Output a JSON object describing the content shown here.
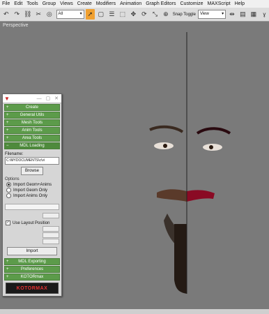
{
  "menu": [
    "File",
    "Edit",
    "Tools",
    "Group",
    "Views",
    "Create",
    "Modifiers",
    "Animation",
    "Graph Editors",
    "Customize",
    "MAXScript",
    "Help"
  ],
  "toolbar": {
    "selection_filter": "All",
    "snap_toggle": "Snap Toggle",
    "view_select": "View"
  },
  "viewport": {
    "label": "Perspective"
  },
  "panel": {
    "rollouts_top": [
      "Create",
      "General Utils",
      "Mesh Tools",
      "Anim Tools",
      "Area Tools"
    ],
    "open_rollout": "MDL Loading",
    "filename_label": "Filename:",
    "filename_value": "C:\\MYDOCUMENTS\\c\\vi",
    "browse": "Browse",
    "options_label": "Options",
    "radios": [
      "Import Geom+Anims",
      "Import Geom Only",
      "Import Anims Only"
    ],
    "radio_selected": 0,
    "use_layout": "Use Layout Position",
    "import": "Import",
    "rollouts_bottom": [
      "MDL Exporting",
      "Preferences",
      "KOTORmax"
    ],
    "logo": "KOTORMAX"
  },
  "colors": {
    "rollout_green": "#5c9b4a",
    "accent_orange": "#f0a030",
    "face_red": "#e0204a"
  }
}
